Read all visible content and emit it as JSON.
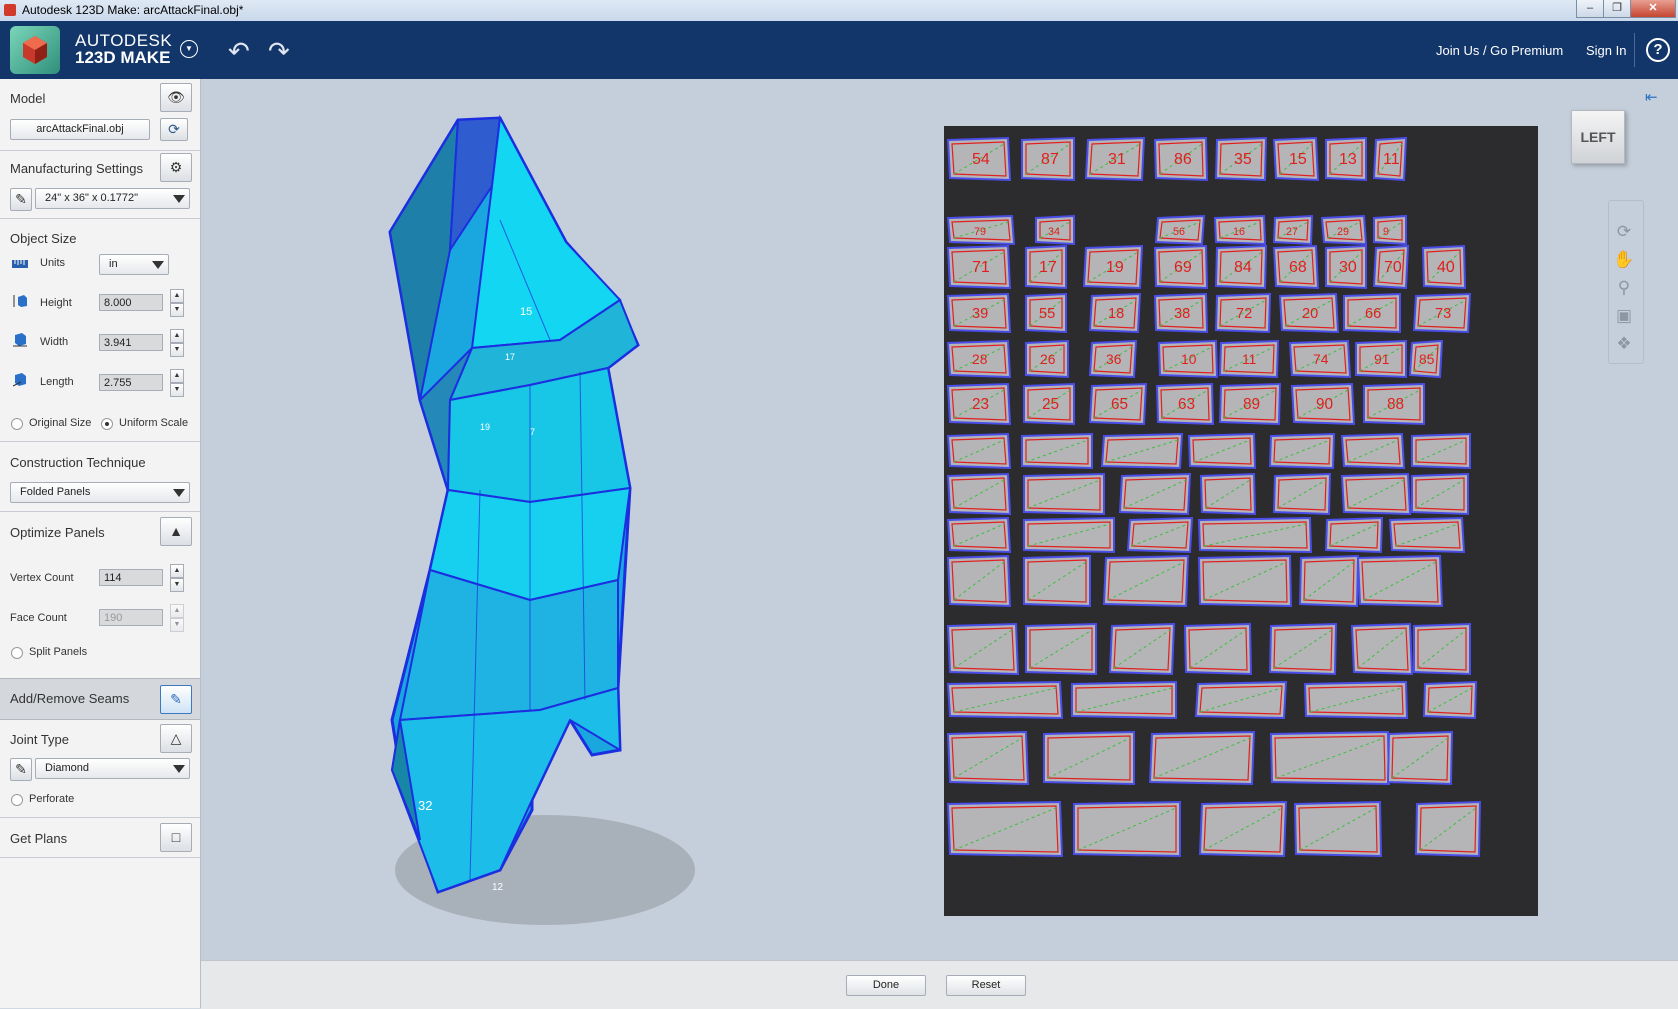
{
  "window": {
    "title": "Autodesk 123D Make: arcAttackFinal.obj*",
    "minimize_icon": "minimize-icon",
    "maximize_icon": "restore-icon",
    "close_icon": "close-icon"
  },
  "header": {
    "brand_line1": "AUTODESK",
    "brand_line2": "123D MAKE",
    "join_label": "Join Us / Go Premium",
    "signin_label": "Sign In",
    "help_label": "?"
  },
  "sidebar": {
    "model": {
      "title": "Model",
      "file_name": "arcAttackFinal.obj"
    },
    "manufacturing": {
      "title": "Manufacturing Settings",
      "sheet": "24\" x 36\" x 0.1772\""
    },
    "object_size": {
      "title": "Object Size",
      "units_label": "Units",
      "units_value": "in",
      "height_label": "Height",
      "height_value": "8.000",
      "width_label": "Width",
      "width_value": "3.941",
      "length_label": "Length",
      "length_value": "2.755",
      "original_size_label": "Original Size",
      "uniform_scale_label": "Uniform Scale"
    },
    "construction": {
      "title": "Construction Technique",
      "value": "Folded Panels"
    },
    "optimize": {
      "title": "Optimize Panels",
      "vertex_label": "Vertex Count",
      "vertex_value": "114",
      "face_label": "Face Count",
      "face_value": "190",
      "split_label": "Split Panels"
    },
    "seams": {
      "title": "Add/Remove Seams"
    },
    "joint": {
      "title": "Joint Type",
      "value": "Diamond",
      "perforate_label": "Perforate"
    },
    "plans": {
      "title": "Get Plans"
    }
  },
  "viewport": {
    "nav_cube_label": "LEFT",
    "model_faces_visible": [
      "15",
      "17",
      "19",
      "7",
      "32",
      "12"
    ],
    "sheet_piece_labels": [
      "54",
      "87",
      "31",
      "86",
      "35",
      "15",
      "13",
      "11",
      "79",
      "34",
      "56",
      "16",
      "27",
      "29",
      "9",
      "71",
      "17",
      "19",
      "69",
      "84",
      "68",
      "30",
      "70",
      "40",
      "39",
      "55",
      "18",
      "38",
      "72",
      "20",
      "66",
      "73",
      "28",
      "26",
      "36",
      "10",
      "11",
      "74",
      "91",
      "85",
      "23",
      "25",
      "65",
      "63",
      "89",
      "90",
      "88"
    ]
  },
  "footer": {
    "done_label": "Done",
    "reset_label": "Reset"
  },
  "colors": {
    "header_bg": "#12366a",
    "model_cyan": "#19c8e8",
    "edge_blue": "#1b2ee0",
    "sheet_bg": "#2c2c2e",
    "cut_red": "#e02020"
  }
}
